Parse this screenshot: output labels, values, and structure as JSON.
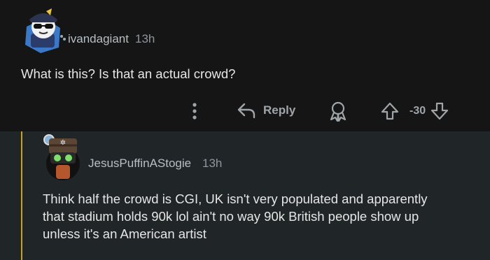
{
  "comments": [
    {
      "username": "ivandagiant",
      "time": "13h",
      "body": "What is this? Is that an actual crowd?",
      "actions": {
        "more_icon": "vertical-ellipsis-icon",
        "reply_label": "Reply",
        "award_icon": "award-icon",
        "score": "-30"
      }
    },
    {
      "username": "JesusPuffinAStogie",
      "time": "13h",
      "body_lines": [
        "Think half the crowd is CGI, UK isn't very populated and apparently",
        "that stadium holds 90k lol ain't no way 90k British people show up",
        "unless it's an American artist"
      ]
    }
  ],
  "colors": {
    "thread_accent": "#c9a227",
    "background": "#151515",
    "nested_background": "#202528"
  }
}
